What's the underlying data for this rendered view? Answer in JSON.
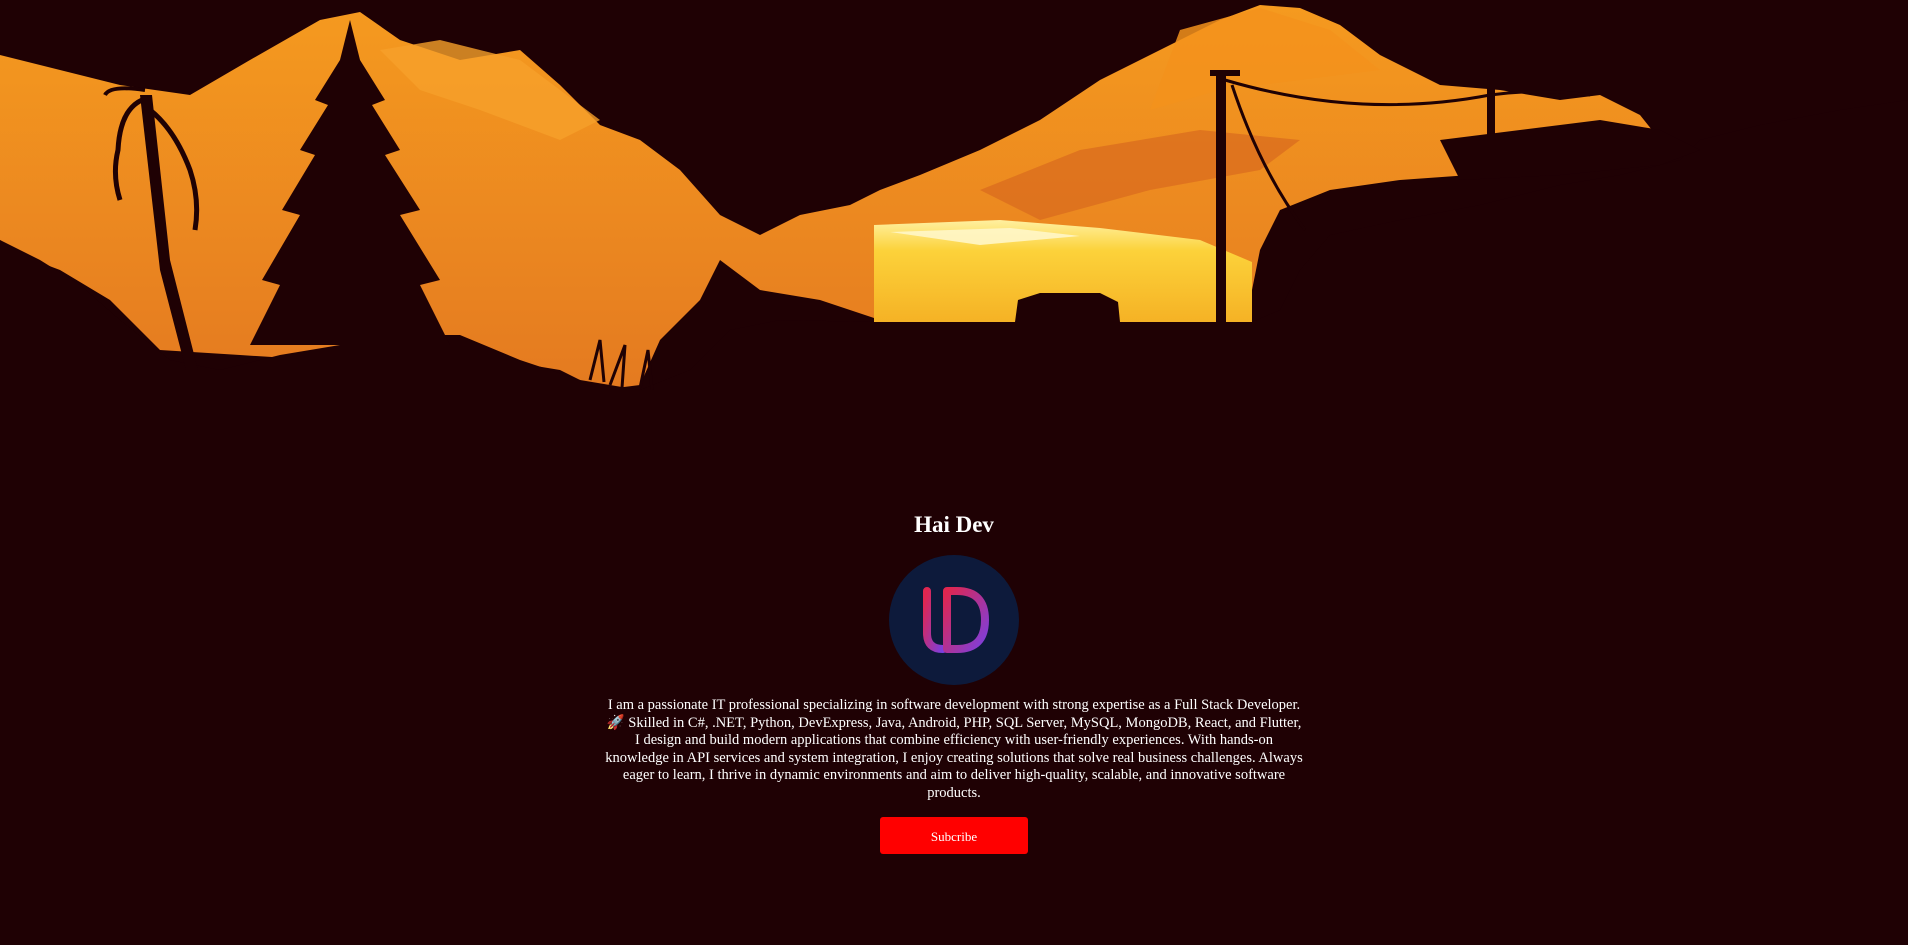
{
  "profile": {
    "name": "Hai Dev",
    "bio": "I am a passionate IT professional specializing in software development with strong expertise as a Full Stack Developer. 🚀 Skilled in C#, .NET, Python, DevExpress, Java, Android, PHP, SQL Server, MySQL, MongoDB, React, and Flutter, I design and build modern applications that combine efficiency with user-friendly experiences. With hands-on knowledge in API services and system integration, I enjoy creating solutions that solve real business challenges. Always eager to learn, I thrive in dynamic environments and aim to deliver high-quality, scalable, and innovative software products.",
    "subscribe_label": "Subcribe"
  },
  "colors": {
    "background": "#1f0104",
    "accent": "#ff0000",
    "sky": "#ee8620",
    "sun": "#fbc62c",
    "avatar_bg": "#0d1a3b"
  },
  "icons": {
    "logo": "monogram-logo",
    "hero": "sunset-landscape-illustration"
  }
}
